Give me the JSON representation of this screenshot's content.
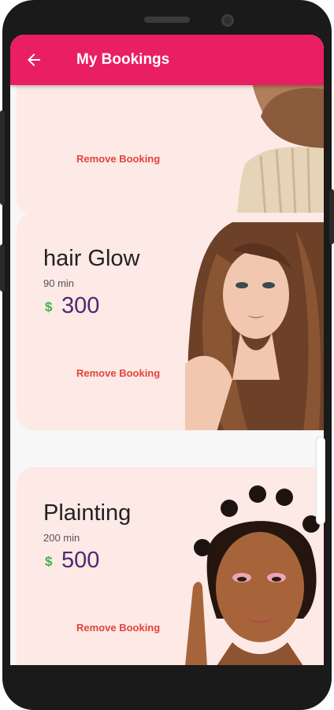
{
  "appbar": {
    "title": "My Bookings",
    "back_icon": "arrow-left-icon"
  },
  "bookings": [
    {
      "name": "",
      "duration": "",
      "currency": "",
      "price": "",
      "remove_label": "Remove Booking"
    },
    {
      "name": "hair Glow",
      "duration": "90 min",
      "currency": "$",
      "price": "300",
      "remove_label": "Remove Booking"
    },
    {
      "name": "Plainting",
      "duration": "200 min",
      "currency": "$",
      "price": "500",
      "remove_label": "Remove Booking"
    }
  ],
  "colors": {
    "accent": "#e91e63",
    "card_bg": "#fde9e6",
    "price": "#4b2a70",
    "currency": "#3bb54a",
    "remove": "#e1443c"
  }
}
